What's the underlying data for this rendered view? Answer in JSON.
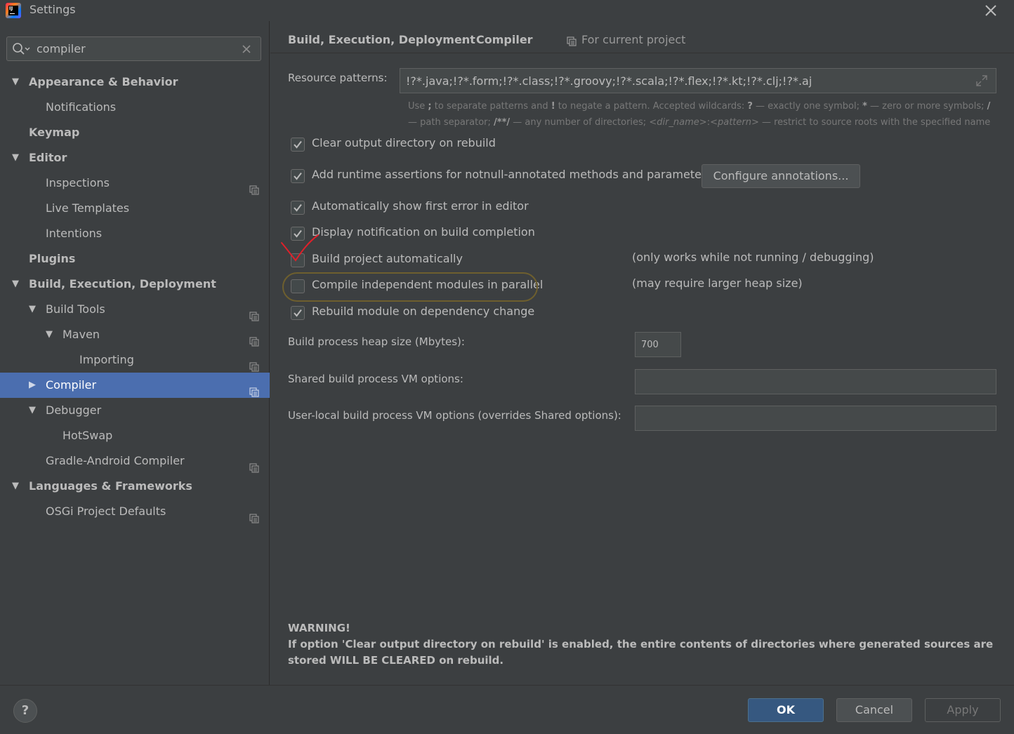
{
  "window": {
    "title": "Settings"
  },
  "search": {
    "value": "compiler"
  },
  "sidebar": {
    "items": [
      {
        "label": "Appearance & Behavior",
        "level": 0,
        "bold": true,
        "arrow": "down",
        "project_icon": false
      },
      {
        "label": "Notifications",
        "level": 1,
        "bold": false,
        "arrow": "",
        "project_icon": false
      },
      {
        "label": "Keymap",
        "level": 0,
        "bold": true,
        "arrow": "",
        "project_icon": false
      },
      {
        "label": "Editor",
        "level": 0,
        "bold": true,
        "arrow": "down",
        "project_icon": false
      },
      {
        "label": "Inspections",
        "level": 1,
        "bold": false,
        "arrow": "",
        "project_icon": true
      },
      {
        "label": "Live Templates",
        "level": 1,
        "bold": false,
        "arrow": "",
        "project_icon": false
      },
      {
        "label": "Intentions",
        "level": 1,
        "bold": false,
        "arrow": "",
        "project_icon": false
      },
      {
        "label": "Plugins",
        "level": 0,
        "bold": true,
        "arrow": "",
        "project_icon": false
      },
      {
        "label": "Build, Execution, Deployment",
        "level": 0,
        "bold": true,
        "arrow": "down",
        "project_icon": false
      },
      {
        "label": "Build Tools",
        "level": 1,
        "bold": false,
        "arrow": "down",
        "project_icon": true
      },
      {
        "label": "Maven",
        "level": 2,
        "bold": false,
        "arrow": "down",
        "project_icon": true
      },
      {
        "label": "Importing",
        "level": 3,
        "bold": false,
        "arrow": "",
        "project_icon": true
      },
      {
        "label": "Compiler",
        "level": 1,
        "bold": false,
        "arrow": "right",
        "project_icon": true,
        "selected": true
      },
      {
        "label": "Debugger",
        "level": 1,
        "bold": false,
        "arrow": "down",
        "project_icon": false
      },
      {
        "label": "HotSwap",
        "level": 2,
        "bold": false,
        "arrow": "",
        "project_icon": false
      },
      {
        "label": "Gradle-Android Compiler",
        "level": 1,
        "bold": false,
        "arrow": "",
        "project_icon": true
      },
      {
        "label": "Languages & Frameworks",
        "level": 0,
        "bold": true,
        "arrow": "down",
        "project_icon": false
      },
      {
        "label": "OSGi Project Defaults",
        "level": 1,
        "bold": false,
        "arrow": "",
        "project_icon": true
      }
    ]
  },
  "header": {
    "crumb_parent": "Build, Execution, Deployment",
    "crumb_current": "Compiler",
    "scope": "For current project"
  },
  "resource": {
    "label": "Resource patterns:",
    "value": "!?*.java;!?*.form;!?*.class;!?*.groovy;!?*.scala;!?*.flex;!?*.kt;!?*.clj;!?*.aj",
    "hint_line1_html": "Use <b>;</b> to separate patterns and <b>!</b> to negate a pattern. Accepted wildcards: <b>?</b> — exactly one symbol; <b>*</b> — zero or more symbols; <b>/</b>",
    "hint_line2_html": "— path separator; <b>/**/</b> — any number of directories; <i>&lt;dir_name&gt;</i>:<i>&lt;pattern&gt;</i> — restrict to source roots with the specified name"
  },
  "options": [
    {
      "label": "Clear output directory on rebuild",
      "checked": true
    },
    {
      "label": "Add runtime assertions for notnull-annotated methods and parameters",
      "checked": true
    },
    {
      "label": "Automatically show first error in editor",
      "checked": true
    },
    {
      "label": "Display notification on build completion",
      "checked": true
    },
    {
      "label": "Build project automatically",
      "checked": false,
      "note": "(only works while not running / debugging)"
    },
    {
      "label": "Compile independent modules in parallel",
      "checked": false,
      "note": "(may require larger heap size)"
    },
    {
      "label": "Rebuild module on dependency change",
      "checked": true
    }
  ],
  "configure_button": "Configure annotations...",
  "heap": {
    "label": "Build process heap size (Mbytes):",
    "value": "700"
  },
  "shared_vm": {
    "label": "Shared build process VM options:",
    "value": ""
  },
  "user_vm": {
    "label": "User-local build process VM options (overrides Shared options):",
    "value": ""
  },
  "warning": {
    "title": "WARNING!",
    "text": "If option 'Clear output directory on rebuild' is enabled, the entire contents of directories where generated sources are stored WILL BE CLEARED on rebuild."
  },
  "buttons": {
    "help": "?",
    "ok": "OK",
    "cancel": "Cancel",
    "apply": "Apply"
  },
  "colors": {
    "selection": "#4b6eaf",
    "primary_button": "#365880",
    "annotation_red": "#e0202a",
    "highlight_oval": "#6e5f2e"
  }
}
